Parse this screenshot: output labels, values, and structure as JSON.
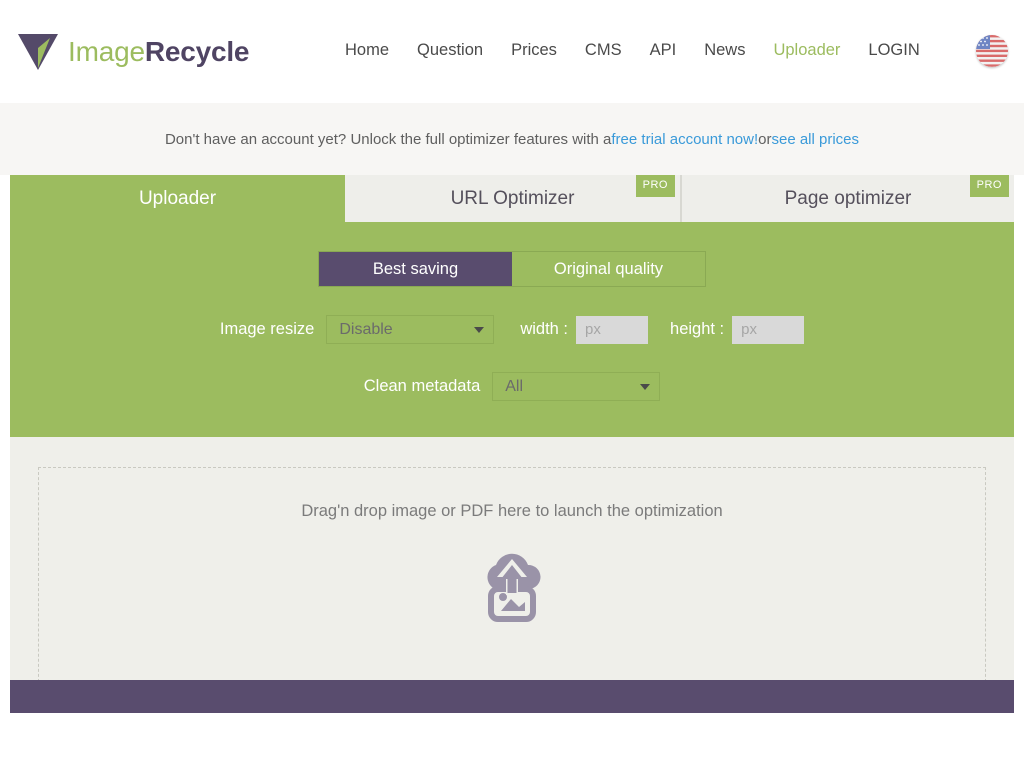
{
  "header": {
    "logo": {
      "icon": "triangle-logo-icon",
      "text_light": "Image",
      "text_bold": "Recycle"
    },
    "nav": [
      {
        "label": "Home",
        "active": false
      },
      {
        "label": "Question",
        "active": false
      },
      {
        "label": "Prices",
        "active": false
      },
      {
        "label": "CMS",
        "active": false
      },
      {
        "label": "API",
        "active": false
      },
      {
        "label": "News",
        "active": false
      },
      {
        "label": "Uploader",
        "active": true
      },
      {
        "label": "LOGIN",
        "active": false
      }
    ],
    "language_flag": "us-flag-icon"
  },
  "announcement": {
    "text_before": "Don't have an account yet? Unlock the full optimizer features with a ",
    "link_1": "free trial account now!",
    "text_middle": " or ",
    "link_2": "see all prices"
  },
  "tabs": [
    {
      "label": "Uploader",
      "active": true,
      "pro": false
    },
    {
      "label": "URL Optimizer",
      "active": false,
      "pro": true,
      "pro_label": "PRO"
    },
    {
      "label": "Page optimizer",
      "active": false,
      "pro": true,
      "pro_label": "PRO"
    }
  ],
  "options": {
    "quality_toggle": {
      "best_saving": "Best saving",
      "original_quality": "Original quality",
      "selected": "Best saving"
    },
    "image_resize": {
      "label": "Image resize",
      "value": "Disable",
      "caret": "chevron-down-icon"
    },
    "width": {
      "label": "width :",
      "value": "",
      "placeholder": "px"
    },
    "height": {
      "label": "height :",
      "value": "",
      "placeholder": "px"
    },
    "clean_metadata": {
      "label": "Clean metadata",
      "value": "All",
      "caret": "chevron-down-icon"
    }
  },
  "dropzone": {
    "text": "Drag'n drop image or PDF here to launch the optimization",
    "icon": "cloud-upload-image-icon"
  },
  "colors": {
    "green": "#9cbc5f",
    "purple": "#594c6e",
    "link_blue": "#3a9ad9",
    "panel_light": "#efefea",
    "announce_bg": "#f7f6f4",
    "tab_inactive": "#eeeeea"
  }
}
